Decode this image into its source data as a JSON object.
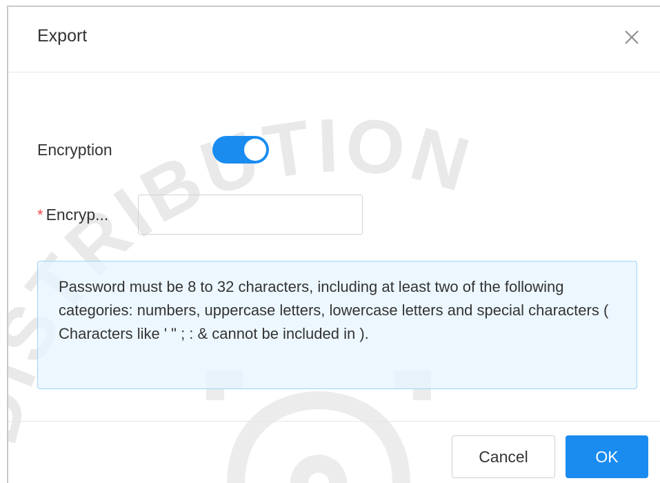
{
  "dialog": {
    "title": "Export",
    "close_icon": "close-icon"
  },
  "form": {
    "encryption": {
      "label": "Encryption",
      "enabled": true
    },
    "password": {
      "required_mark": "*",
      "label": "Encryp...",
      "value": "",
      "placeholder": ""
    },
    "tip": "Password must be 8 to 32 characters, including at least two of the following categories: numbers, uppercase letters, lowercase letters and special characters ( Characters like ' \" ; : & cannot be included in )."
  },
  "footer": {
    "cancel_label": "Cancel",
    "ok_label": "OK"
  },
  "watermark": {
    "text": "DISTRIBUTION"
  },
  "colors": {
    "accent": "#1a8cf0",
    "required": "#f04747",
    "tip_background": "#e5f4ff",
    "tip_border": "#9fd4f6"
  }
}
